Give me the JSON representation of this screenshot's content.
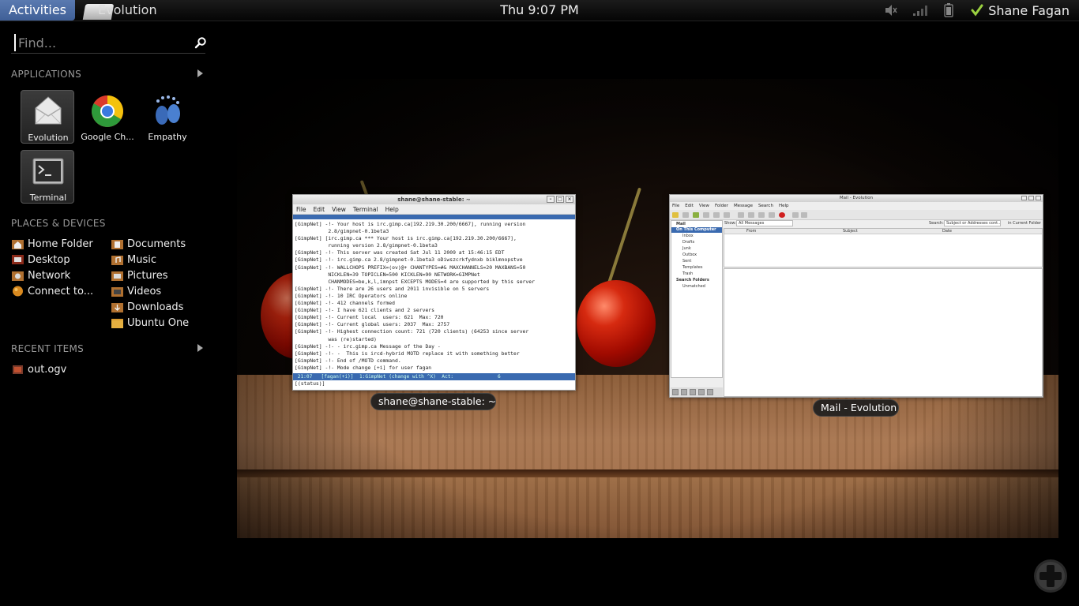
{
  "top_panel": {
    "activities_label": "Activities",
    "app_name": "Evolution",
    "clock": "Thu  9:07 PM",
    "user_name": "Shane Fagan"
  },
  "search": {
    "placeholder": "Find..."
  },
  "applications": {
    "header": "APPLICATIONS",
    "items": [
      {
        "label": "Evolution",
        "icon": "evolution-icon"
      },
      {
        "label": "Google Ch...",
        "icon": "google-chrome-icon"
      },
      {
        "label": "Empathy",
        "icon": "empathy-icon"
      },
      {
        "label": "Terminal",
        "icon": "terminal-icon"
      }
    ]
  },
  "places": {
    "header": "PLACES & DEVICES",
    "left": [
      {
        "label": "Home Folder",
        "icon": "home-folder-icon"
      },
      {
        "label": "Desktop",
        "icon": "desktop-icon"
      },
      {
        "label": "Network",
        "icon": "network-icon"
      },
      {
        "label": "Connect to...",
        "icon": "connect-icon"
      }
    ],
    "right": [
      {
        "label": "Documents",
        "icon": "documents-folder-icon"
      },
      {
        "label": "Music",
        "icon": "music-folder-icon"
      },
      {
        "label": "Pictures",
        "icon": "pictures-folder-icon"
      },
      {
        "label": "Videos",
        "icon": "videos-folder-icon"
      },
      {
        "label": "Downloads",
        "icon": "downloads-folder-icon"
      },
      {
        "label": "Ubuntu One",
        "icon": "ubuntu-one-folder-icon"
      }
    ]
  },
  "recent": {
    "header": "RECENT ITEMS",
    "items": [
      {
        "label": "out.ogv",
        "icon": "video-file-icon"
      }
    ]
  },
  "terminal_window": {
    "title": "shane@shane-stable: ~",
    "caption": "shane@shane-stable: ~",
    "menu": [
      "File",
      "Edit",
      "View",
      "Terminal",
      "Help"
    ],
    "lines": [
      "[GimpNet] -!- Your host is irc.gimp.ca[192.219.30.200/6667], running version",
      "           2.8/gimpnet-0.1beta3",
      "[GimpNet] [irc.gimp.ca *** Your host is irc.gimp.ca[192.219.30.200/6667],",
      "           running version 2.8/gimpnet-0.1beta3",
      "[GimpNet] -!- This server was created Sat Jul 11 2009 at 15:46:15 EDT",
      "[GimpNet] -!- irc.gimp.ca 2.8/gimpnet-0.1beta3 oDiwszcrkfydnxb biklmnopstve",
      "[GimpNet] -!- WALLCHOPS PREFIX=(ov)@+ CHANTYPES=#& MAXCHANNELS=20 MAXBANS=50",
      "           NICKLEN=39 TOPICLEN=500 KICKLEN=90 NETWORK=GIMPNet",
      "           CHANMODES=be,k,l,imnpst EXCEPTS MODES=4 are supported by this server",
      "[GimpNet] -!- There are 26 users and 2011 invisible on 5 servers",
      "[GimpNet] -!- 10 IRC Operators online",
      "[GimpNet] -!- 412 channels formed",
      "[GimpNet] -!- I have 621 clients and 2 servers",
      "[GimpNet] -!- Current local  users: 621  Max: 720",
      "[GimpNet] -!- Current global users: 2037  Max: 2757",
      "[GimpNet] -!- Highest connection count: 721 (720 clients) (64253 since server",
      "           was (re)started)",
      "[GimpNet] -!- - irc.gimp.ca Message of the Day -",
      "[GimpNet] -!- -  This is ircd-hybrid MOTD replace it with something better",
      "[GimpNet] -!- End of /MOTD command.",
      "[GimpNet] -!- Mode change [+i] for user fagan"
    ],
    "status_line": " 21:07   [fagan(+i)]  1:GimpNet (change with ^X)  Act:               6",
    "prompt": "[(status)] "
  },
  "evolution_window": {
    "title": "Mail - Evolution",
    "caption": "Mail - Evolution",
    "menu": [
      "File",
      "Edit",
      "View",
      "Folder",
      "Message",
      "Search",
      "Help"
    ],
    "show_label": "Show:",
    "show_value": "All Messages",
    "search_label": "Search:",
    "search_value": "Subject or Addresses cont...",
    "search_scope": "in Current Folder",
    "sidebar_header": "Mail",
    "sidebar_group": "On This Computer",
    "folders": [
      "Inbox",
      "Drafts",
      "Junk",
      "Outbox",
      "Sent",
      "Templates",
      "Trash"
    ],
    "search_folders": "Search Folders",
    "unmatched": "Unmatched",
    "columns": [
      "From",
      "Subject",
      "Date"
    ]
  },
  "colors": {
    "activities_bg": "#4a6ba3",
    "selection_blue": "#3a6ab0"
  }
}
